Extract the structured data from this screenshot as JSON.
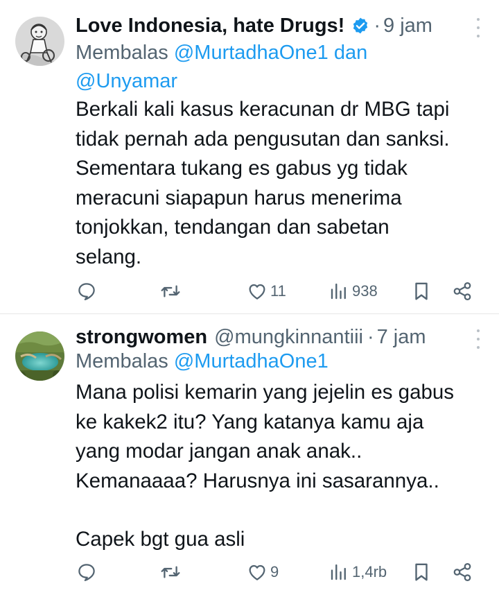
{
  "colors": {
    "text": "#0f1419",
    "muted": "#536471",
    "link": "#1d9bf0",
    "verified": "#1d9bf0",
    "divider": "#e6e6e6"
  },
  "tweets": [
    {
      "display_name": "Love Indonesia, hate Drugs!",
      "verified": true,
      "handle": "",
      "time": "9 jam",
      "reply_prefix": "Membalas",
      "reply_to_1": "@MurtadhaOne1",
      "reply_joiner": "dan",
      "reply_to_2": "@Unyamar",
      "body_lines": [
        "Berkali kali kasus keracunan dr MBG tapi",
        "tidak pernah ada pengusutan dan sanksi.",
        "Sementara tukang es gabus yg tidak",
        "meracuni siapapun harus menerima",
        "tonjokkan, tendangan dan sabetan",
        "selang."
      ],
      "avatar_icon": "cartoon-person-avatar",
      "stats": {
        "replies": "",
        "retweets": "",
        "likes": "11",
        "views": "938"
      }
    },
    {
      "display_name": "strongwomen",
      "verified": false,
      "handle": "@mungkinnantiii",
      "time": "7 jam",
      "reply_prefix": "Membalas",
      "reply_to_1": "@MurtadhaOne1",
      "body_lines": [
        "Mana polisi kemarin yang jejelin es gabus",
        "ke kakek2 itu? Yang katanya kamu aja",
        "yang modar jangan anak anak..",
        "Kemanaaaa? Harusnya ini sasarannya..",
        "",
        "Capek bgt gua asli"
      ],
      "avatar_icon": "landscape-photo-avatar",
      "stats": {
        "replies": "",
        "retweets": "",
        "likes": "9",
        "views": "1,4rb"
      }
    }
  ]
}
